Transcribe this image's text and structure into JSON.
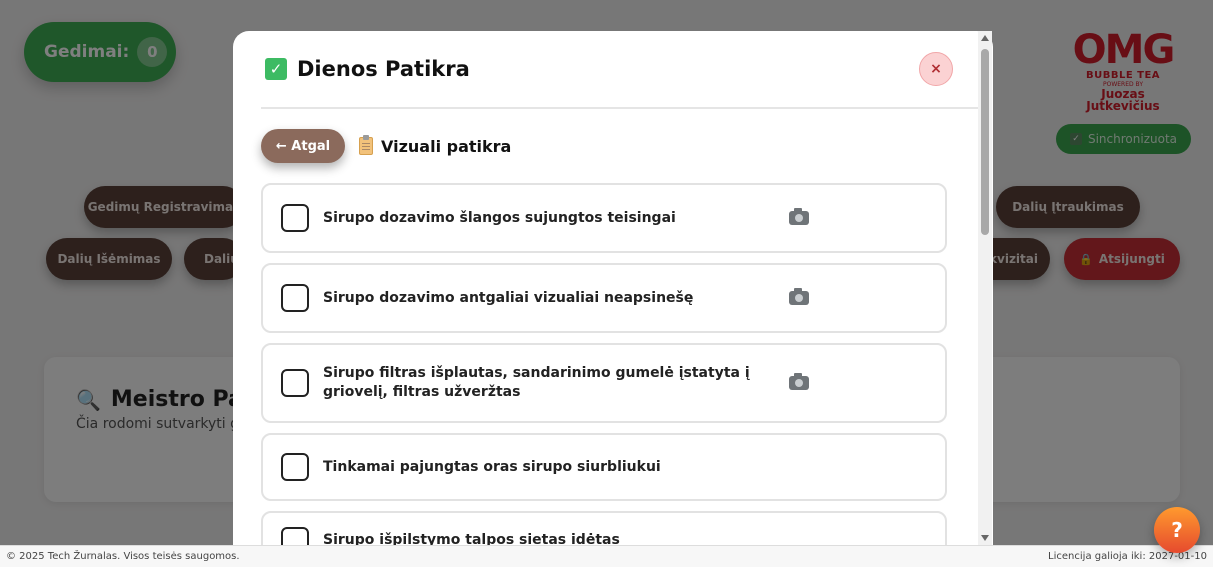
{
  "background": {
    "counter": {
      "label": "Gedimai:",
      "value": "0"
    },
    "brand": {
      "logo": "OMG",
      "sub": "BUBBLE TEA",
      "tiny": "POWERED BY",
      "name1": "Juozas",
      "name2": "Jutkevičius"
    },
    "sync_label": "Sinchronizuota",
    "nav": {
      "gedimu_registravimas": "Gedimų Registravimas",
      "daliu_itraukimas": "Dalių Įtraukimas",
      "daliu_isemimas": "Dalių Išėmimas",
      "daliu_partial": "Dalių",
      "rekvizitai_partial": "kvizitai",
      "atsijungti": "Atsijungti"
    },
    "meistro": {
      "title": "Meistro Pat",
      "subtitle": "Čia rodomi sutvarkyti ge"
    },
    "footer": {
      "copyright": "© 2025 Tech Žurnalas. Visos teisės saugomos.",
      "license": "Licencija galioja iki: 2027-01-10"
    },
    "help_label": "?"
  },
  "modal": {
    "title": "Dienos Patikra",
    "close_label": "×",
    "back_label": "← Atgal",
    "section_title": "Vizuali patikra",
    "items": [
      {
        "label": "Sirupo dozavimo šlangos sujungtos teisingai"
      },
      {
        "label": "Sirupo dozavimo antgaliai vizualiai neapsinešę"
      },
      {
        "label": "Sirupo filtras išplautas, sandarinimo gumelė įstatyta į griovelį, filtras užveržtas"
      },
      {
        "label": "Tinkamai pajungtas oras sirupo siurbliukui"
      },
      {
        "label": "Sirupo išpilstymo talpos sietas idėtas"
      }
    ]
  },
  "colors": {
    "accent_brown": "#8b6a5c",
    "success_green": "#3dbb63",
    "danger_red": "#c72f36"
  }
}
